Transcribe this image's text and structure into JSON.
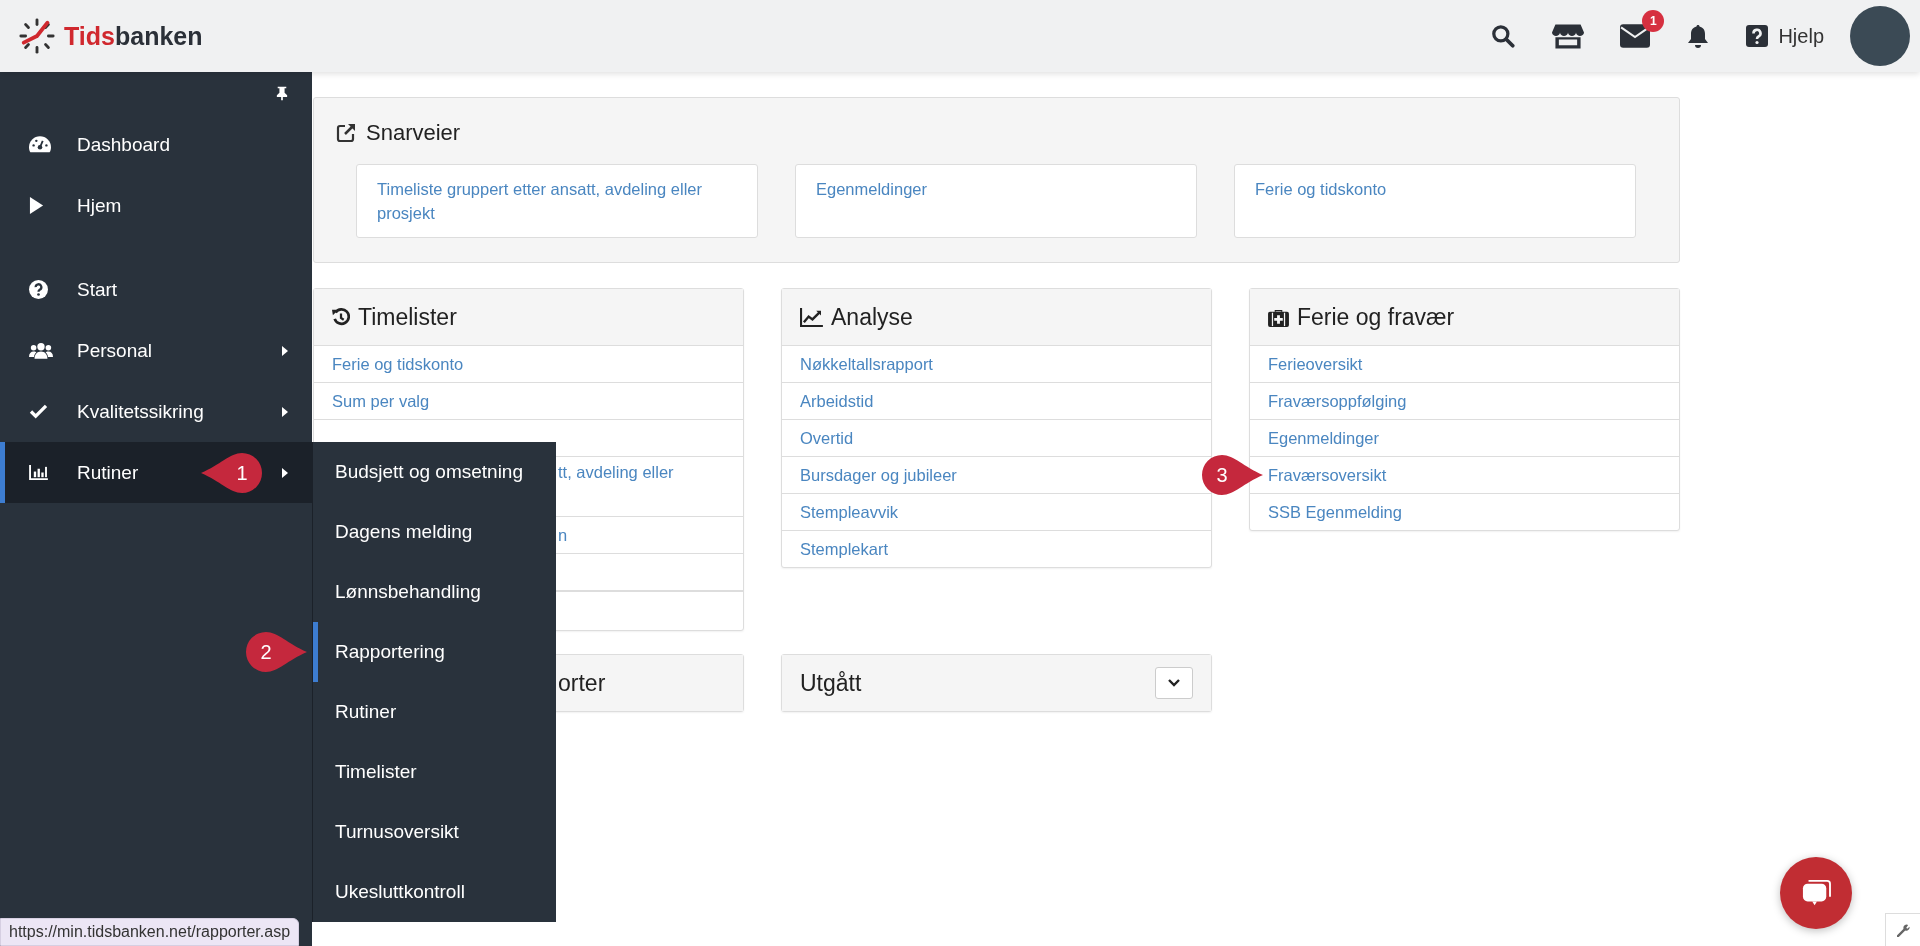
{
  "topbar": {
    "brand_prefix": "Tids",
    "brand_suffix": "banken",
    "mail_badge": "1",
    "help_label": "Hjelp"
  },
  "sidebar": {
    "groups": [
      [
        {
          "label": "Dashboard",
          "selected": false,
          "submenu": false
        },
        {
          "label": "Hjem",
          "selected": false,
          "submenu": false
        }
      ],
      [
        {
          "label": "Start",
          "selected": false,
          "submenu": false
        },
        {
          "label": "Personal",
          "selected": false,
          "submenu": true,
          "expanded": false
        },
        {
          "label": "Kvalitetssikring",
          "selected": false,
          "submenu": true,
          "expanded": false
        },
        {
          "label": "Rutiner",
          "selected": true,
          "submenu": true,
          "expanded": true,
          "marker": "1",
          "children": [
            {
              "label": "Budsjett og omsetning",
              "selected": false
            },
            {
              "label": "Dagens melding",
              "selected": false
            },
            {
              "label": "Lønnsbehandling",
              "selected": false
            },
            {
              "label": "Rapportering",
              "selected": true,
              "marker": "2"
            },
            {
              "label": "Rutiner",
              "selected": false
            },
            {
              "label": "Timelister",
              "selected": false
            },
            {
              "label": "Turnusoversikt",
              "selected": false
            },
            {
              "label": "Ukesluttkontroll",
              "selected": false
            }
          ]
        }
      ]
    ]
  },
  "shortcuts": {
    "title": "Snarveier",
    "links": [
      "Timeliste gruppert etter ansatt, avdeling eller prosjekt",
      "Egenmeldinger",
      "Ferie og tidskonto"
    ]
  },
  "panels": [
    {
      "title": "Timelister",
      "obscured": false,
      "rows": [
        {
          "kind": "link",
          "text": "Ferie og tidskonto",
          "obscured": false
        },
        {
          "kind": "link",
          "text": "Sum per valg",
          "obscured": false
        },
        {
          "kind": "blank"
        },
        {
          "kind": "wrapped",
          "text": "tt, avdeling eller",
          "obscured": true
        },
        {
          "kind": "link",
          "text": "n",
          "obscured": true
        },
        {
          "kind": "blank"
        },
        {
          "kind": "footer"
        }
      ]
    },
    {
      "title": "Analyse",
      "obscured": false,
      "rows": [
        {
          "kind": "link",
          "text": "Nøkkeltallsrapport",
          "obscured": false
        },
        {
          "kind": "link",
          "text": "Arbeidstid",
          "obscured": false
        },
        {
          "kind": "link",
          "text": "Overtid",
          "obscured": false
        },
        {
          "kind": "link",
          "text": "Bursdager og jubileer",
          "obscured": false
        },
        {
          "kind": "link",
          "text": "Stempleavvik",
          "obscured": false
        },
        {
          "kind": "link",
          "text": "Stemplekart",
          "obscured": false
        }
      ]
    },
    {
      "title": "Ferie og fravær",
      "obscured": false,
      "rows": [
        {
          "kind": "link",
          "text": "Ferieoversikt",
          "obscured": false
        },
        {
          "kind": "link",
          "text": "Fraværsoppfølging",
          "obscured": false
        },
        {
          "kind": "link",
          "text": "Egenmeldinger",
          "obscured": false
        },
        {
          "kind": "link",
          "text": "Fraværsoversikt",
          "obscured": false,
          "marker": "3"
        },
        {
          "kind": "link",
          "text": "SSB Egenmelding",
          "obscured": false
        }
      ]
    },
    {
      "title": "orter",
      "obscured": true,
      "collapsible": false
    },
    {
      "title": "Utgått",
      "obscured": false,
      "collapsible": true
    }
  ],
  "status_url": "https://min.tidsbanken.net/rapporter.asp"
}
